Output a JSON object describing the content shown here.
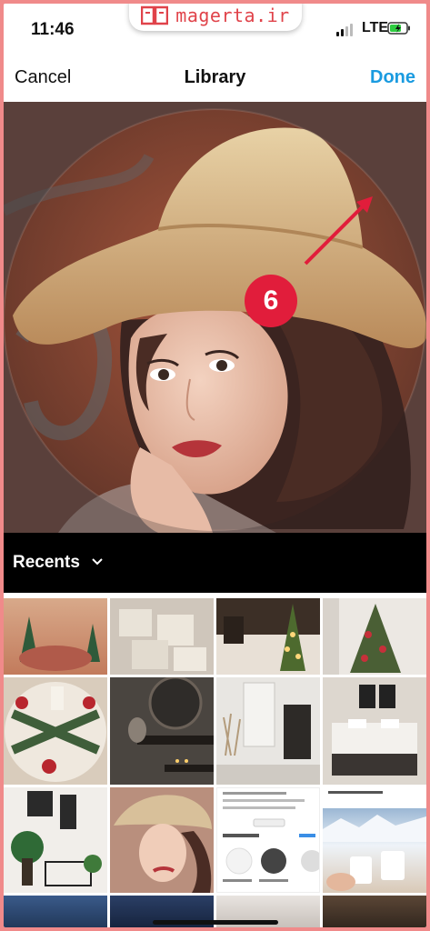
{
  "status_bar": {
    "time": "11:46",
    "brand": "magerta.ir",
    "network": "LTE"
  },
  "nav": {
    "cancel": "Cancel",
    "title": "Library",
    "done": "Done"
  },
  "annotation": {
    "step": "6",
    "color": "#e11d3b"
  },
  "recents": {
    "label": "Recents"
  },
  "colors": {
    "accent": "#1a9be0",
    "brand": "#e0434a",
    "border": "#f08a8a"
  }
}
